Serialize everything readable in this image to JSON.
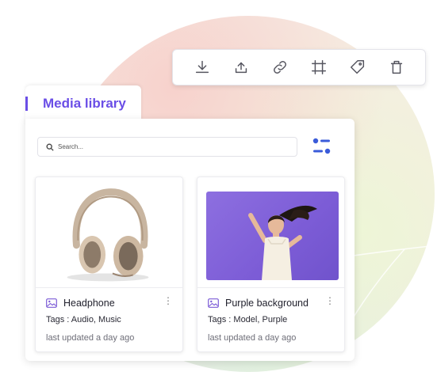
{
  "toolbar": {
    "buttons": [
      {
        "icon": "download-icon"
      },
      {
        "icon": "upload-icon"
      },
      {
        "icon": "link-icon"
      },
      {
        "icon": "crop-icon"
      },
      {
        "icon": "tag-icon"
      },
      {
        "icon": "trash-icon"
      }
    ]
  },
  "library": {
    "tab_label": "Media library",
    "accent_color": "#6a4ee6"
  },
  "search": {
    "placeholder": "Search...",
    "value": ""
  },
  "cards": [
    {
      "title": "Headphone",
      "tags": "Tags : Audio, Music",
      "updated": "last updated a day ago",
      "menu": "⋮",
      "icon": "image-icon"
    },
    {
      "title": "Purple background",
      "tags": "Tags : Model, Purple",
      "updated": "last updated a day ago",
      "menu": "⋮",
      "icon": "image-icon"
    }
  ]
}
